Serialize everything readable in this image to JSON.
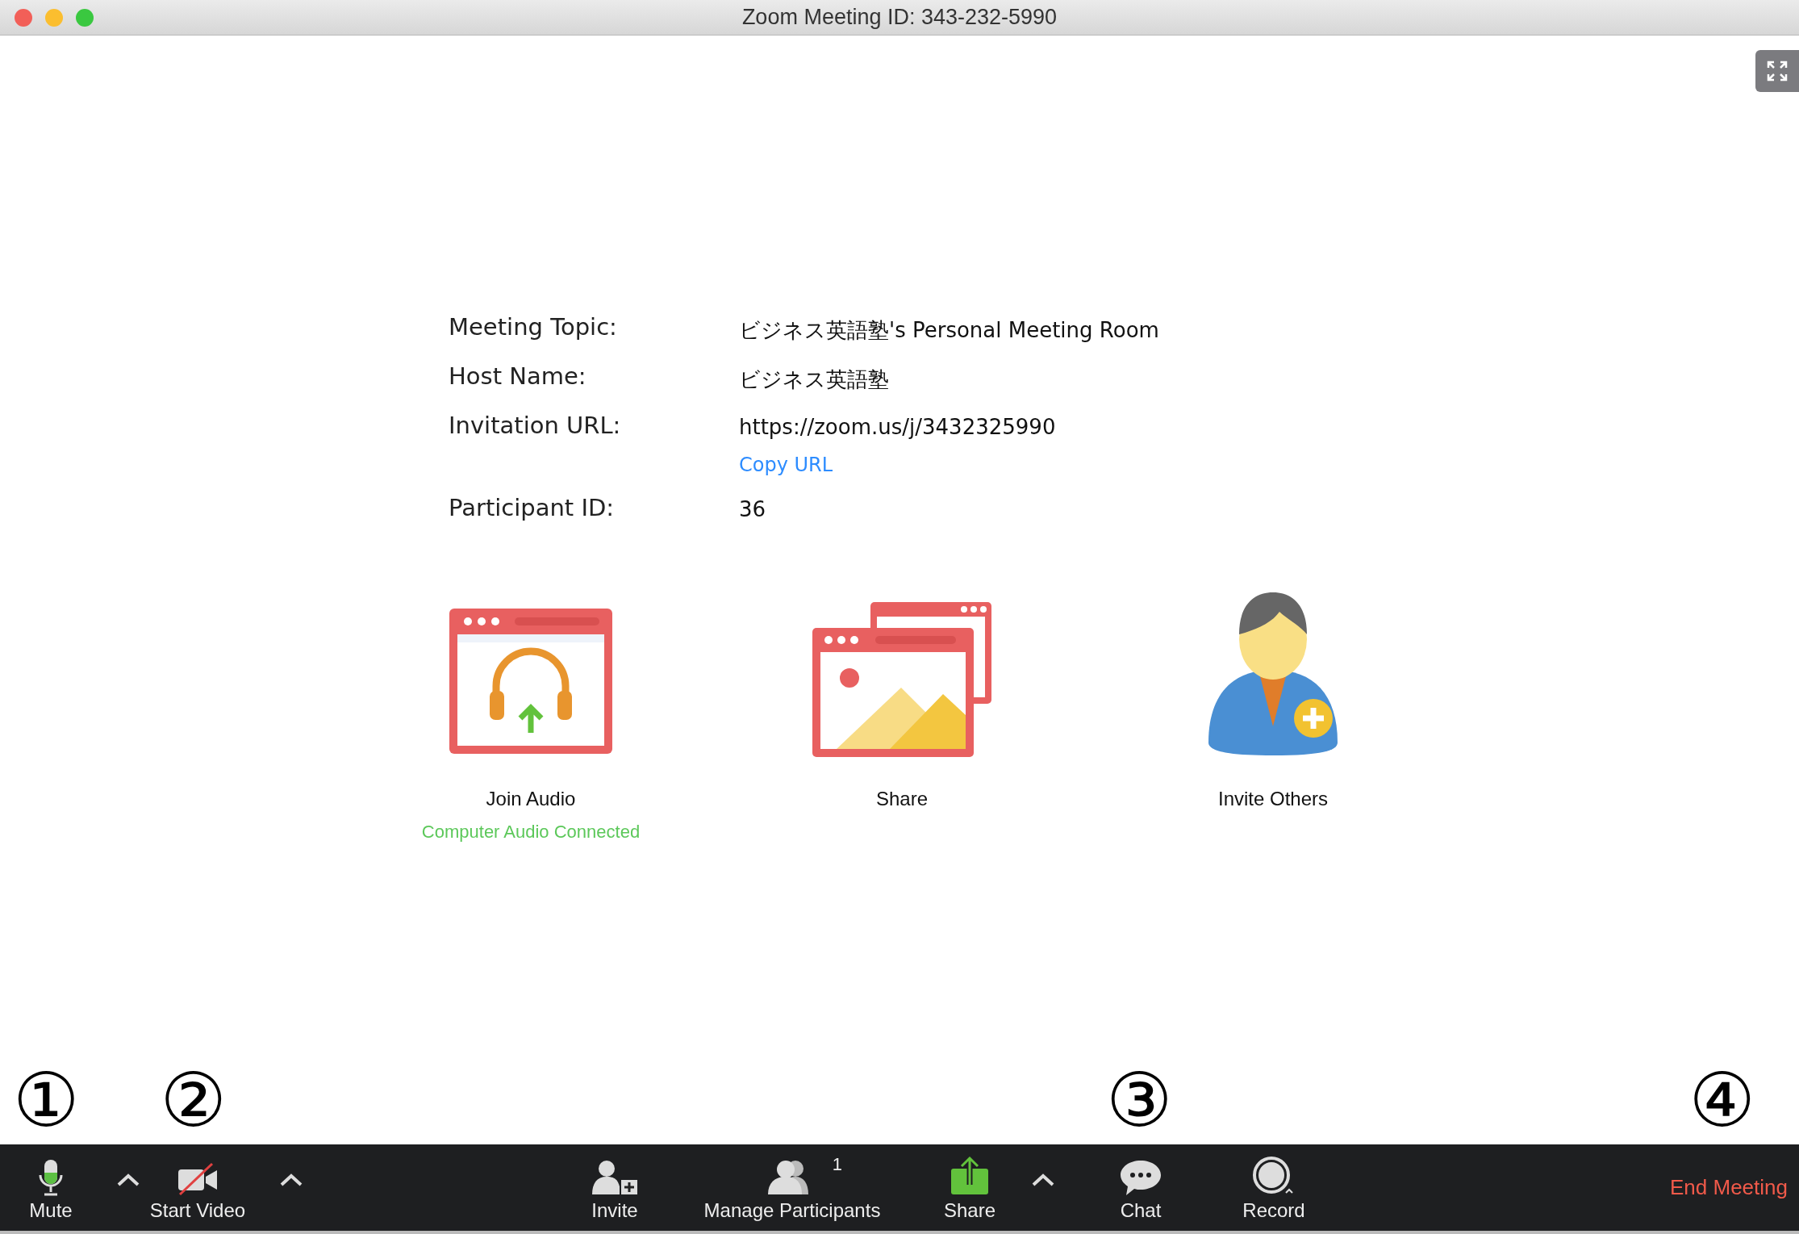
{
  "window": {
    "title": "Zoom Meeting ID: 343-232-5990"
  },
  "meeting_info": [
    {
      "label": "Meeting Topic:",
      "value": "ビジネス英語塾's Personal Meeting Room"
    },
    {
      "label": "Host Name:",
      "value": "ビジネス英語塾"
    },
    {
      "label": "Invitation URL:",
      "value": "https://zoom.us/j/3432325990",
      "link": "Copy URL"
    },
    {
      "label": "Participant ID:",
      "value": "36"
    }
  ],
  "actions": [
    {
      "kind": "audio",
      "label": "Join Audio",
      "status": "Computer Audio Connected"
    },
    {
      "kind": "share",
      "label": "Share"
    },
    {
      "kind": "invite",
      "label": "Invite Others"
    }
  ],
  "annotations": [
    "①",
    "②",
    "③",
    "④"
  ],
  "toolbar": {
    "left": [
      {
        "kind": "mic",
        "label": "Mute"
      },
      {
        "kind": "caret"
      },
      {
        "kind": "video_off",
        "label": "Start Video"
      },
      {
        "kind": "caret"
      }
    ],
    "center": [
      {
        "kind": "invite",
        "label": "Invite"
      },
      {
        "kind": "participants",
        "label": "Manage Participants",
        "count": "1"
      },
      {
        "kind": "share",
        "label": "Share"
      },
      {
        "kind": "caret"
      },
      {
        "kind": "chat",
        "label": "Chat"
      },
      {
        "kind": "record",
        "label": "Record"
      }
    ],
    "end_button": "End Meeting"
  }
}
